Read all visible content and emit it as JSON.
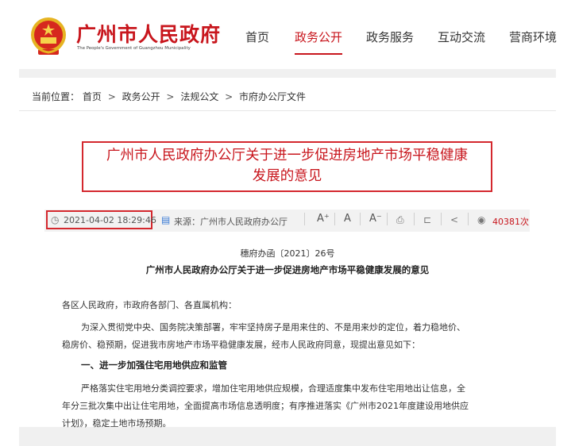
{
  "header": {
    "site_name": "广州市人民政府",
    "site_name_en": "The People's Government of Guangzhou Municipality",
    "nav": [
      "首页",
      "政务公开",
      "政务服务",
      "互动交流",
      "营商环境"
    ],
    "active_nav": "政务公开"
  },
  "breadcrumb": {
    "prefix": "当前位置：",
    "items": [
      "首页",
      "政务公开",
      "法规公文",
      "市府办公厅文件"
    ],
    "sep": ">"
  },
  "article": {
    "title_line1": "广州市人民政府办公厅关于进一步促进房地产市场平稳健康",
    "title_line2": "发展的意见",
    "date": "2021-04-02 18:29:46",
    "source": "来源：广州市人民政府办公厅",
    "font_tools": [
      "A⁺",
      "A",
      "A⁻"
    ],
    "views": "40381次",
    "doc_no": "穗府办函〔2021〕26号",
    "doc_title": "广州市人民政府办公厅关于进一步促进房地产市场平稳健康发展的意见",
    "salutation": "各区人民政府，市政府各部门、各直属机构：",
    "para1_l1": "为深入贯彻党中央、国务院决策部署，牢牢坚持房子是用来住的、不是用来炒的定位，着力稳地价、",
    "para1_l2": "稳房价、稳预期，促进我市房地产市场平稳健康发展，经市人民政府同意，现提出意见如下：",
    "section1": "一、进一步加强住宅用地供应和监管",
    "para2_l1": "严格落实住宅用地分类调控要求，增加住宅用地供应规模，合理适度集中发布住宅用地出让信息，全",
    "para2_l2": "年分三批次集中出让住宅用地，全面提高市场信息透明度；有序推进落实《广州市2021年度建设用地供应",
    "para2_l3": "计划》，稳定土地市场预期。"
  },
  "colors": {
    "brand": "#c8161d",
    "highlight_box": "#d4282e"
  },
  "icons": [
    "guangzhou-emblem-icon",
    "clock-icon",
    "source-doc-icon",
    "print-icon",
    "bookmark-icon",
    "share-icon",
    "eye-icon"
  ]
}
